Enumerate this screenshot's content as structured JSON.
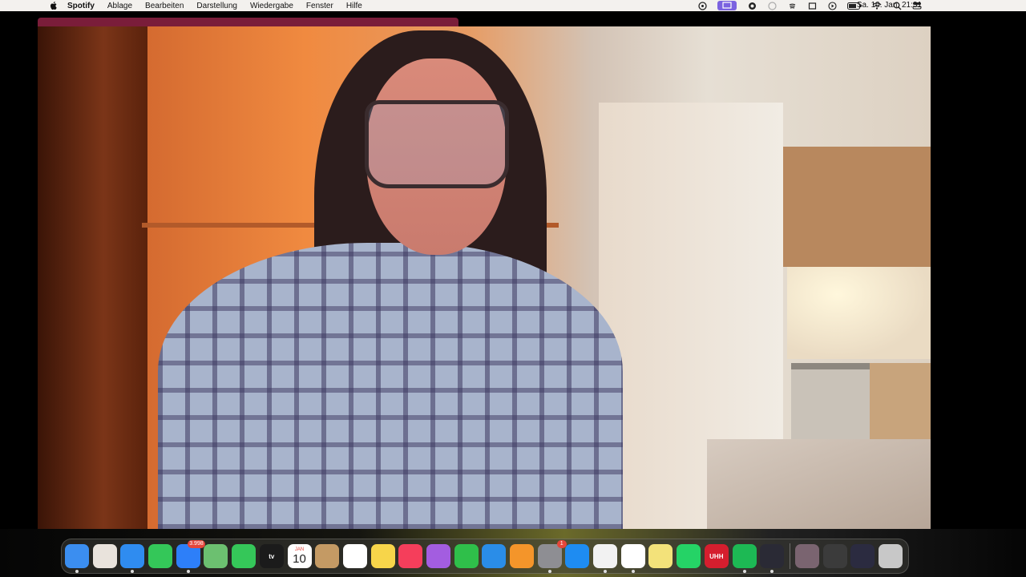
{
  "menubar": {
    "apple_icon": "apple-icon",
    "app_name": "Spotify",
    "menus": [
      "Ablage",
      "Bearbeiten",
      "Darstellung",
      "Wiedergabe",
      "Fenster",
      "Hilfe"
    ],
    "status_icons": [
      "creative-cloud-icon",
      "screen-share-icon",
      "vpn-icon",
      "circle-icon",
      "spotify-mini-icon",
      "window-icon",
      "play-icon",
      "battery-icon",
      "wifi-icon",
      "search-icon",
      "control-center-icon"
    ],
    "clock": "Sa. 10. Jan.  21:31"
  },
  "dock": {
    "apps": [
      {
        "name": "Finder",
        "icon": "finder-icon",
        "color": "#3b8ef0",
        "running": true
      },
      {
        "name": "Launchpad",
        "icon": "launchpad-icon",
        "color": "#e9e3dc",
        "running": false
      },
      {
        "name": "Safari",
        "icon": "safari-icon",
        "color": "#2f8cf0",
        "running": true
      },
      {
        "name": "Messages",
        "icon": "messages-icon",
        "color": "#34c759",
        "running": false
      },
      {
        "name": "Mail",
        "icon": "mail-icon",
        "color": "#2d7ff9",
        "running": true,
        "badge": "3.998"
      },
      {
        "name": "Maps",
        "icon": "maps-icon",
        "color": "#6cc070",
        "running": false
      },
      {
        "name": "FaceTime",
        "icon": "facetime-icon",
        "color": "#35c759",
        "running": false
      },
      {
        "name": "TV",
        "icon": "tv-icon",
        "color": "#1b1b1b",
        "running": false,
        "label": "tv"
      },
      {
        "name": "Calendar",
        "icon": "calendar-icon",
        "color": "#ffffff",
        "running": false,
        "cal_month": "JAN",
        "cal_day": "10"
      },
      {
        "name": "Contacts",
        "icon": "contacts-icon",
        "color": "#c49a64",
        "running": false
      },
      {
        "name": "Reminders",
        "icon": "reminders-icon",
        "color": "#ffffff",
        "running": false
      },
      {
        "name": "Notes",
        "icon": "notes-icon",
        "color": "#f7d54a",
        "running": false
      },
      {
        "name": "Music",
        "icon": "music-icon",
        "color": "#f53e5b",
        "running": false
      },
      {
        "name": "Podcasts",
        "icon": "podcasts-icon",
        "color": "#a35de0",
        "running": false
      },
      {
        "name": "Numbers",
        "icon": "numbers-icon",
        "color": "#2fbf4a",
        "running": false
      },
      {
        "name": "Keynote",
        "icon": "keynote-icon",
        "color": "#2a8de8",
        "running": false
      },
      {
        "name": "Pages",
        "icon": "pages-icon",
        "color": "#f4952a",
        "running": false
      },
      {
        "name": "System Settings",
        "icon": "settings-icon",
        "color": "#8e8e93",
        "running": true,
        "badge": "1"
      },
      {
        "name": "App Store",
        "icon": "app-store-icon",
        "color": "#1e8cf2",
        "running": false
      },
      {
        "name": "Chrome",
        "icon": "chrome-icon",
        "color": "#f2f2f2",
        "running": true
      },
      {
        "name": "ChatGPT",
        "icon": "chatgpt-icon",
        "color": "#ffffff",
        "running": true
      },
      {
        "name": "Stickies",
        "icon": "stickies-icon",
        "color": "#f3e27a",
        "running": false
      },
      {
        "name": "WhatsApp",
        "icon": "whatsapp-icon",
        "color": "#25d366",
        "running": false
      },
      {
        "name": "Uni app",
        "icon": "uhh-icon",
        "color": "#d51e2e",
        "running": false,
        "label": "UHH"
      },
      {
        "name": "Spotify",
        "icon": "spotify-icon",
        "color": "#1db954",
        "running": true
      },
      {
        "name": "OBS",
        "icon": "obs-icon",
        "color": "#2a2a35",
        "running": true
      }
    ],
    "recents": [
      {
        "name": "Photo Booth window",
        "icon": "photo-thumbnail-icon",
        "color": "#7a6470"
      },
      {
        "name": "Preview",
        "icon": "preview-icon",
        "color": "#3b3b3b"
      },
      {
        "name": "Screenshot",
        "icon": "screenshot-thumbnail-icon",
        "color": "#2b2b40"
      },
      {
        "name": "Trash",
        "icon": "trash-icon",
        "color": "#c8c8c8"
      }
    ]
  }
}
